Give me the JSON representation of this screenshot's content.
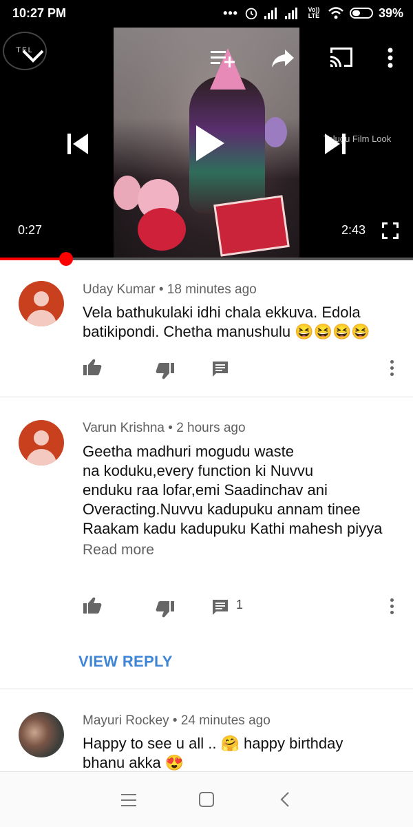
{
  "status": {
    "time": "10:27 PM",
    "dots": "•••",
    "network_label": "Vo)) LTE",
    "battery": "39%"
  },
  "player": {
    "logo_text": "TFL",
    "watermark": "Telugu Film Look",
    "current_time": "0:27",
    "total_time": "2:43",
    "progress": 0.16,
    "icons": [
      "chevron-down-icon",
      "add-to-queue-icon",
      "share-icon",
      "cast-icon",
      "more-vert-icon",
      "previous-icon",
      "play-icon",
      "next-icon",
      "fullscreen-icon"
    ]
  },
  "comments": [
    {
      "author": "Uday Kumar",
      "age": "18 minutes ago",
      "meta": "Uday Kumar • 18 minutes ago",
      "text": "Vela bathukulaki idhi chala ekkuva. Edola batikipondi. Chetha manushulu 😆😆😆😆",
      "replies": ""
    },
    {
      "author": "Varun Krishna",
      "age": "2 hours ago",
      "meta": "Varun Krishna • 2 hours ago",
      "lines": [
        "Geetha madhuri mogudu waste",
        "na koduku,every function ki Nuvvu",
        "enduku raa lofar,emi Saadinchav ani",
        "Overacting.Nuvvu kadupuku annam tinee",
        "Raakam kadu kadupuku Kathi mahesh piyya"
      ],
      "read_more": "Read more",
      "replies": "1",
      "view_reply": "VIEW REPLY"
    },
    {
      "author": "Mayuri Rockey",
      "age": "24 minutes ago",
      "meta": "Mayuri Rockey • 24 minutes ago",
      "lines": [
        "Happy to see u all .. 🤗 happy birthday",
        "bhanu akka 😍"
      ]
    }
  ],
  "colors": {
    "accent": "#3e85d6",
    "progress": "#ff0000",
    "avatar_default": "#c8401e"
  }
}
